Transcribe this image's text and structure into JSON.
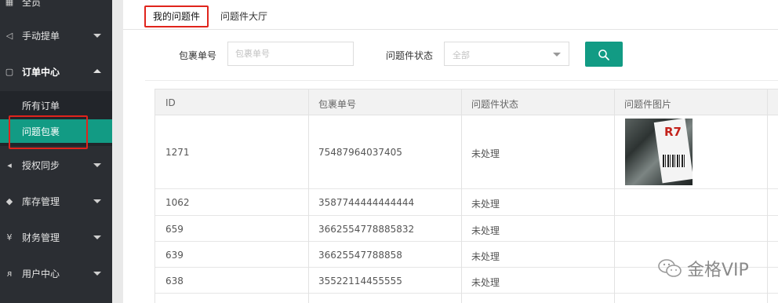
{
  "sidebar": {
    "items": [
      {
        "label": "全员",
        "icon": "grid-icon"
      },
      {
        "label": "手动提单",
        "icon": "send-icon"
      },
      {
        "label": "订单中心",
        "icon": "order-icon"
      },
      {
        "label": "授权同步",
        "icon": "share-icon"
      },
      {
        "label": "库存管理",
        "icon": "layers-icon"
      },
      {
        "label": "财务管理",
        "icon": "yen-icon"
      },
      {
        "label": "用户中心",
        "icon": "user-icon"
      }
    ],
    "submenu": [
      {
        "label": "所有订单"
      },
      {
        "label": "问题包裹"
      }
    ]
  },
  "tabs": [
    {
      "label": "我的问题件"
    },
    {
      "label": "问题件大厅"
    }
  ],
  "filters": {
    "package_label": "包裹单号",
    "package_placeholder": "包裹单号",
    "status_label": "问题件状态",
    "status_value": "全部"
  },
  "table": {
    "headers": [
      "ID",
      "包裹单号",
      "问题件状态",
      "问题件图片"
    ],
    "rows": [
      {
        "id": "1271",
        "package": "75487964037405",
        "status": "未处理"
      },
      {
        "id": "1062",
        "package": "3587744444444444",
        "status": "未处理"
      },
      {
        "id": "659",
        "package": "3662554778885832",
        "status": "未处理"
      },
      {
        "id": "639",
        "package": "36625547788858",
        "status": "未处理"
      },
      {
        "id": "638",
        "package": "35522114455555",
        "status": "未处理"
      }
    ]
  },
  "photo_label_text": "R7",
  "watermark": "金格VIP",
  "colors": {
    "accent": "#129b84",
    "sidebar_bg": "#2b2e33",
    "highlight_box": "#e0241c"
  }
}
